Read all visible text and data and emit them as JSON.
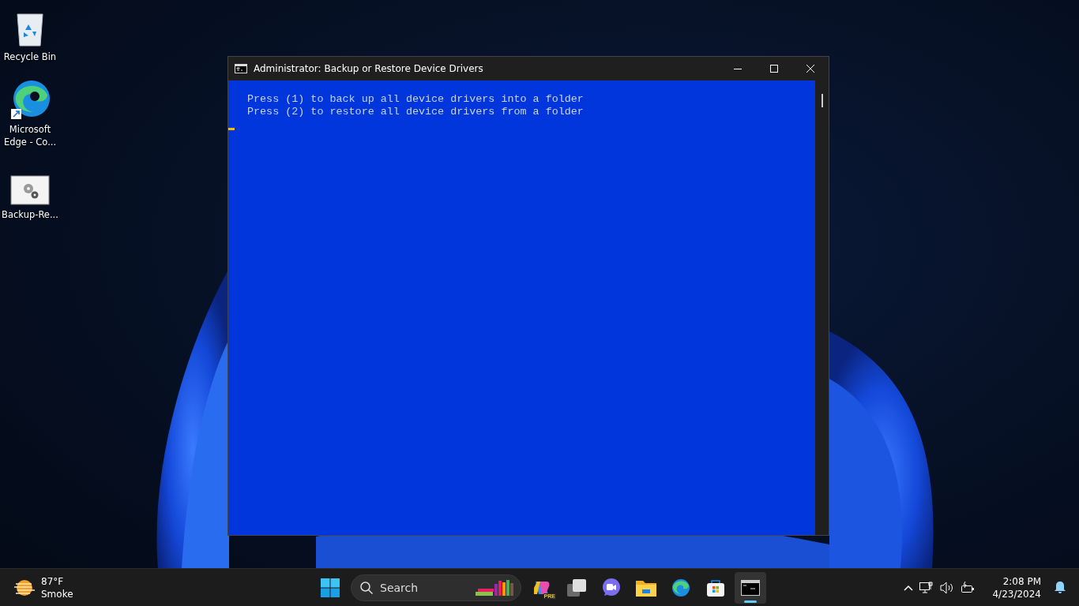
{
  "desktop_icons": [
    {
      "kind": "recycle-bin",
      "label": "Recycle Bin"
    },
    {
      "kind": "browser-shortcut",
      "label": "Microsoft Edge - Co..."
    },
    {
      "kind": "settings-file",
      "label": "Backup-Re..."
    }
  ],
  "window": {
    "title": "Administrator:  Backup or Restore Device Drivers",
    "lines": [
      "Press (1) to back up all device drivers into a folder",
      "Press (2) to restore all device drivers from a folder"
    ],
    "cursor": true
  },
  "taskbar": {
    "weather": {
      "temperature": "87°F",
      "condition": "Smoke"
    },
    "search": {
      "placeholder": "Search"
    },
    "apps": [
      {
        "kind": "start",
        "active": false
      },
      {
        "kind": "search"
      },
      {
        "kind": "copilot",
        "badge": "PRE",
        "active": false
      },
      {
        "kind": "task-view",
        "active": false
      },
      {
        "kind": "video-chat",
        "active": false
      },
      {
        "kind": "folder",
        "active": false
      },
      {
        "kind": "browser",
        "active": false
      },
      {
        "kind": "store",
        "active": false
      },
      {
        "kind": "terminal",
        "active": true
      }
    ],
    "tray": {
      "time": "2:08 PM",
      "date": "4/23/2024"
    }
  }
}
